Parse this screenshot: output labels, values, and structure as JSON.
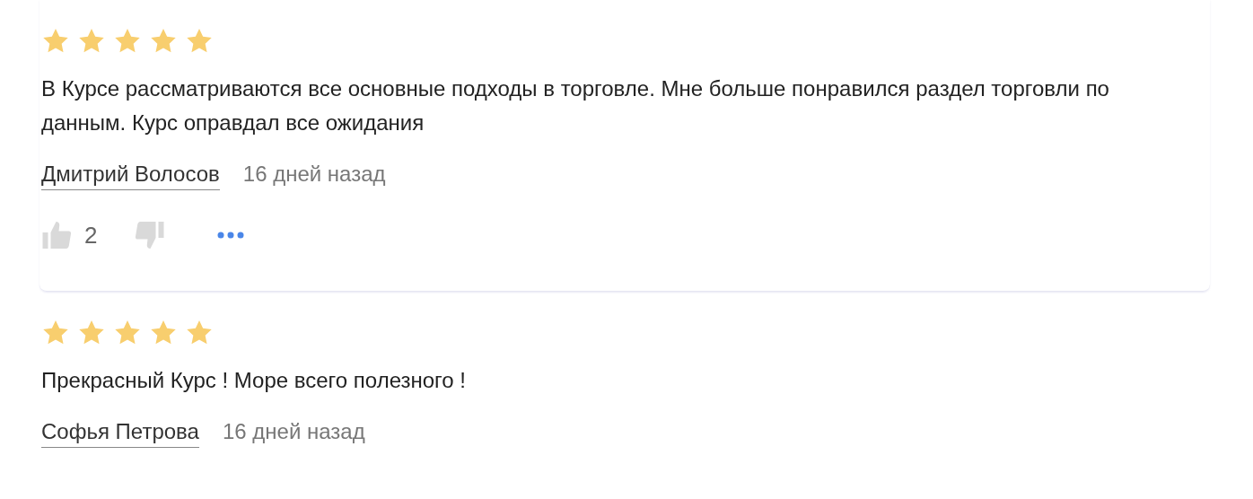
{
  "reviews": [
    {
      "stars": 5,
      "text": "В Курсе рассматриваются все основные подходы в торговле. Мне больше понравился раздел торговли по данным. Курс оправдал все ожидания",
      "author": "Дмитрий Волосов",
      "date": "16 дней назад",
      "actions": {
        "likes": "2"
      }
    },
    {
      "stars": 5,
      "text": "Прекрасный Курс ! Море всего полезного !",
      "author": "Софья Петрова",
      "date": "16 дней назад"
    }
  ]
}
